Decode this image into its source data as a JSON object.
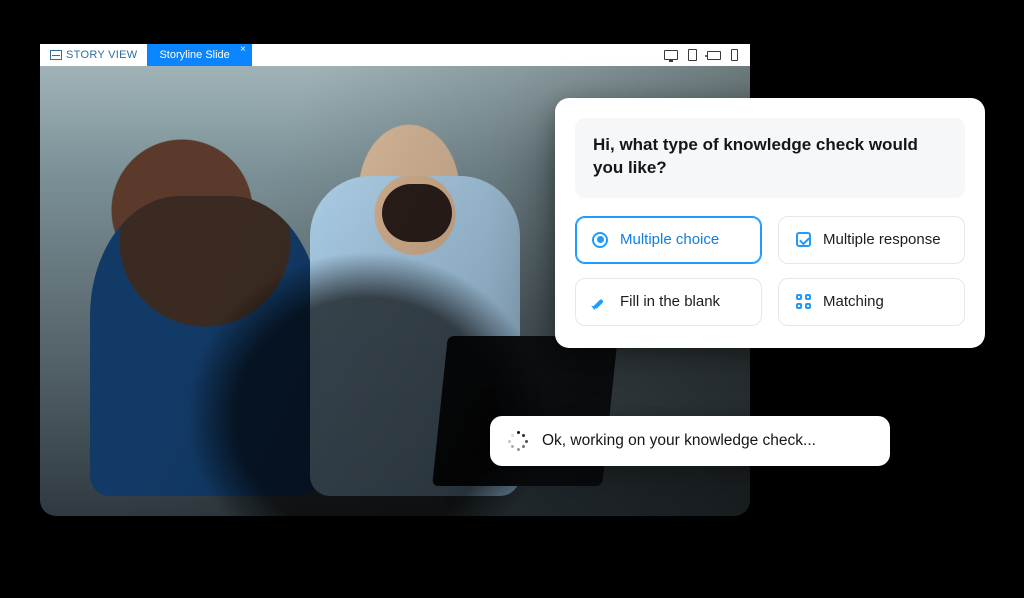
{
  "appbar": {
    "story_view_label": "STORY VIEW",
    "active_tab_label": "Storyline Slide",
    "device_icons": [
      "monitor",
      "tablet",
      "tablet-landscape",
      "phone"
    ]
  },
  "assistant": {
    "prompt": "Hi, what type of knowledge check would you like?",
    "options": [
      {
        "id": "multiple-choice",
        "label": "Multiple choice",
        "icon": "radio-selected",
        "selected": true
      },
      {
        "id": "multiple-response",
        "label": "Multiple response",
        "icon": "checkbox",
        "selected": false
      },
      {
        "id": "fill-in-blank",
        "label": "Fill in the blank",
        "icon": "pencil",
        "selected": false
      },
      {
        "id": "matching",
        "label": "Matching",
        "icon": "grid",
        "selected": false
      }
    ],
    "status_text": "Ok, working on your knowledge check..."
  },
  "colors": {
    "accent": "#1e9bff",
    "tab": "#0a84ff"
  }
}
